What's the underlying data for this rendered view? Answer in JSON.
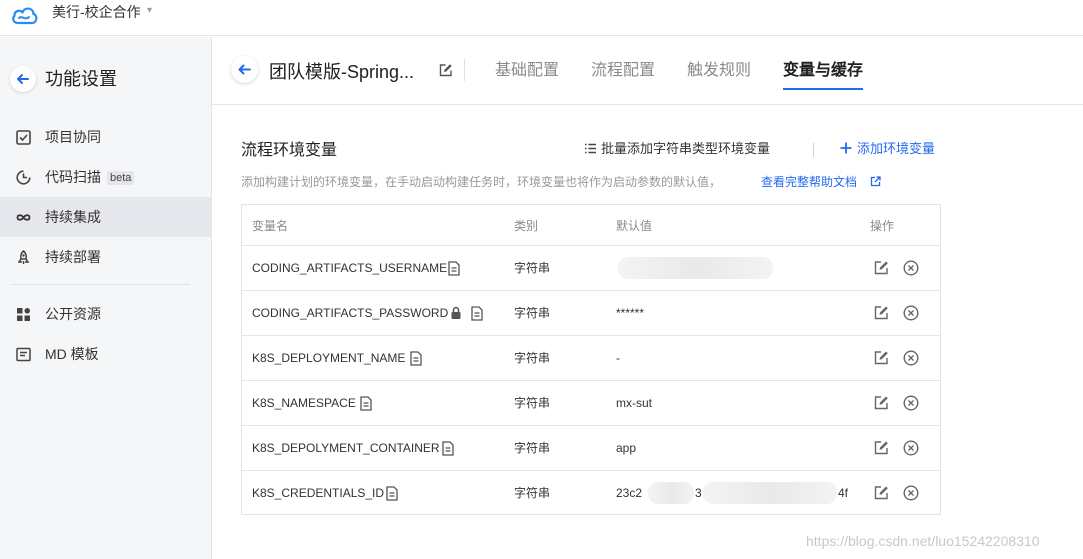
{
  "topbar": {
    "team_name": "美行-校企合作",
    "caret": "▾"
  },
  "sidebar": {
    "title": "功能设置",
    "items": [
      {
        "label": "项目协同",
        "icon": "checkbox-icon"
      },
      {
        "label": "代码扫描",
        "icon": "scan-icon",
        "badge": "beta"
      },
      {
        "label": "持续集成",
        "icon": "infinity-icon",
        "active": true
      },
      {
        "label": "持续部署",
        "icon": "rocket-icon"
      },
      {
        "label": "公开资源",
        "icon": "grid-icon"
      },
      {
        "label": "MD 模板",
        "icon": "template-icon"
      }
    ]
  },
  "header": {
    "title": "团队模版-Spring...",
    "tabs": [
      {
        "label": "基础配置"
      },
      {
        "label": "流程配置"
      },
      {
        "label": "触发规则"
      },
      {
        "label": "变量与缓存",
        "active": true
      }
    ]
  },
  "section": {
    "title": "流程环境变量",
    "batch_add_label": "批量添加字符串类型环境变量",
    "add_label": "添加环境变量",
    "description": "添加构建计划的环境变量，在手动启动构建任务时，环境变量也将作为启动参数的默认值，",
    "help_link": "查看完整帮助文档"
  },
  "table": {
    "headers": {
      "name": "变量名",
      "type": "类别",
      "default": "默认值",
      "actions": "操作"
    },
    "rows": [
      {
        "name": "CODING_ARTIFACTS_USERNAME",
        "type": "字符串",
        "value": "",
        "value_prefix": "",
        "value_suffix": "",
        "locked": false
      },
      {
        "name": "CODING_ARTIFACTS_PASSWORD",
        "type": "字符串",
        "value": "******",
        "locked": true
      },
      {
        "name": "K8S_DEPLOYMENT_NAME",
        "type": "字符串",
        "value": "-",
        "locked": false
      },
      {
        "name": "K8S_NAMESPACE",
        "type": "字符串",
        "value": "mx-sut",
        "locked": false
      },
      {
        "name": "K8S_DEPOLYMENT_CONTAINER",
        "type": "字符串",
        "value": "app",
        "locked": false
      },
      {
        "name": "K8S_CREDENTIALS_ID",
        "type": "字符串",
        "value_prefix": "23c2",
        "value_mid": "3",
        "value_suffix": "4f",
        "locked": false
      }
    ]
  },
  "watermark": "https://blog.csdn.net/luo15242208310",
  "colors": {
    "accent": "#2468f2",
    "sidebar_bg": "#f5f6f8",
    "active_item_bg": "#e6e8ee"
  }
}
